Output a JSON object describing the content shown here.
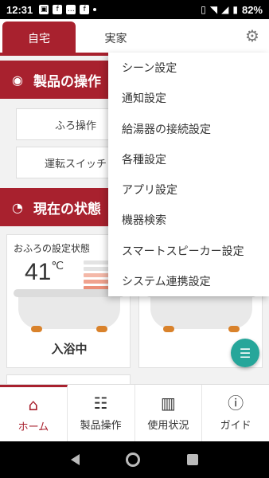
{
  "status_bar": {
    "time": "12:31",
    "battery": "82%"
  },
  "tabs": {
    "home": "自宅",
    "family": "実家"
  },
  "sections": {
    "operation": "製品の操作",
    "status": "現在の状態"
  },
  "operation_buttons": {
    "bath": "ふろ操作",
    "power": "運転スイッチ"
  },
  "bath_card": {
    "title": "おふろの設定状態",
    "temperature": "41",
    "unit": "℃",
    "status": "入浴中"
  },
  "menu": {
    "items": [
      "シーン設定",
      "通知設定",
      "給湯器の接続設定",
      "各種設定",
      "アプリ設定",
      "機器検索",
      "スマートスピーカー設定",
      "システム連携設定"
    ]
  },
  "bottom_nav": {
    "home": "ホーム",
    "products": "製品操作",
    "usage": "使用状況",
    "guide": "ガイド"
  },
  "colors": {
    "accent": "#a8212e",
    "fab": "#26a69a",
    "tub_feet": "#d9822b"
  }
}
